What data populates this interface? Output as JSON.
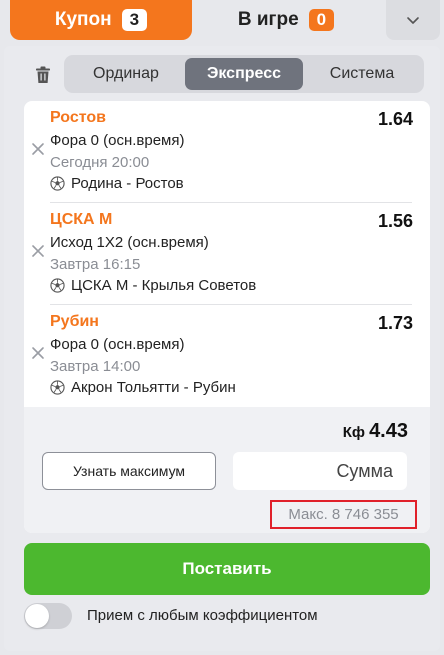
{
  "tabs": {
    "coupon": {
      "label": "Купон",
      "count": "3"
    },
    "in_game": {
      "label": "В игре",
      "count": "0"
    }
  },
  "bet_types": {
    "items": [
      "Ординар",
      "Экспресс",
      "Система"
    ],
    "active": "Экспресс"
  },
  "bets": [
    {
      "team": "Ростов",
      "odd": "1.64",
      "market": "Фора 0 (осн.время)",
      "time": "Сегодня 20:00",
      "match": "Родина - Ростов"
    },
    {
      "team": "ЦСКА М",
      "odd": "1.56",
      "market": "Исход 1X2 (осн.время)",
      "time": "Завтра 16:15",
      "match": "ЦСКА М - Крылья Советов"
    },
    {
      "team": "Рубин",
      "odd": "1.73",
      "market": "Фора 0 (осн.время)",
      "time": "Завтра 14:00",
      "match": "Акрон Тольятти - Рубин"
    }
  ],
  "summary": {
    "kf_label": "Кф",
    "kf_value": "4.43",
    "max_button": "Узнать максимум",
    "amount_placeholder": "Сумма",
    "max_text": "Макс. 8 746 355"
  },
  "place_button": "Поставить",
  "accept_any_odds": {
    "label": "Прием с любым коэффициентом",
    "enabled": false
  },
  "colors": {
    "accent": "#f4761d",
    "success": "#4cb82f",
    "highlight": "#e0202a"
  },
  "icons": {
    "trash": "trash-icon",
    "collapse": "chevron-down-icon",
    "remove": "close-icon",
    "sport": "soccer-ball-icon"
  }
}
